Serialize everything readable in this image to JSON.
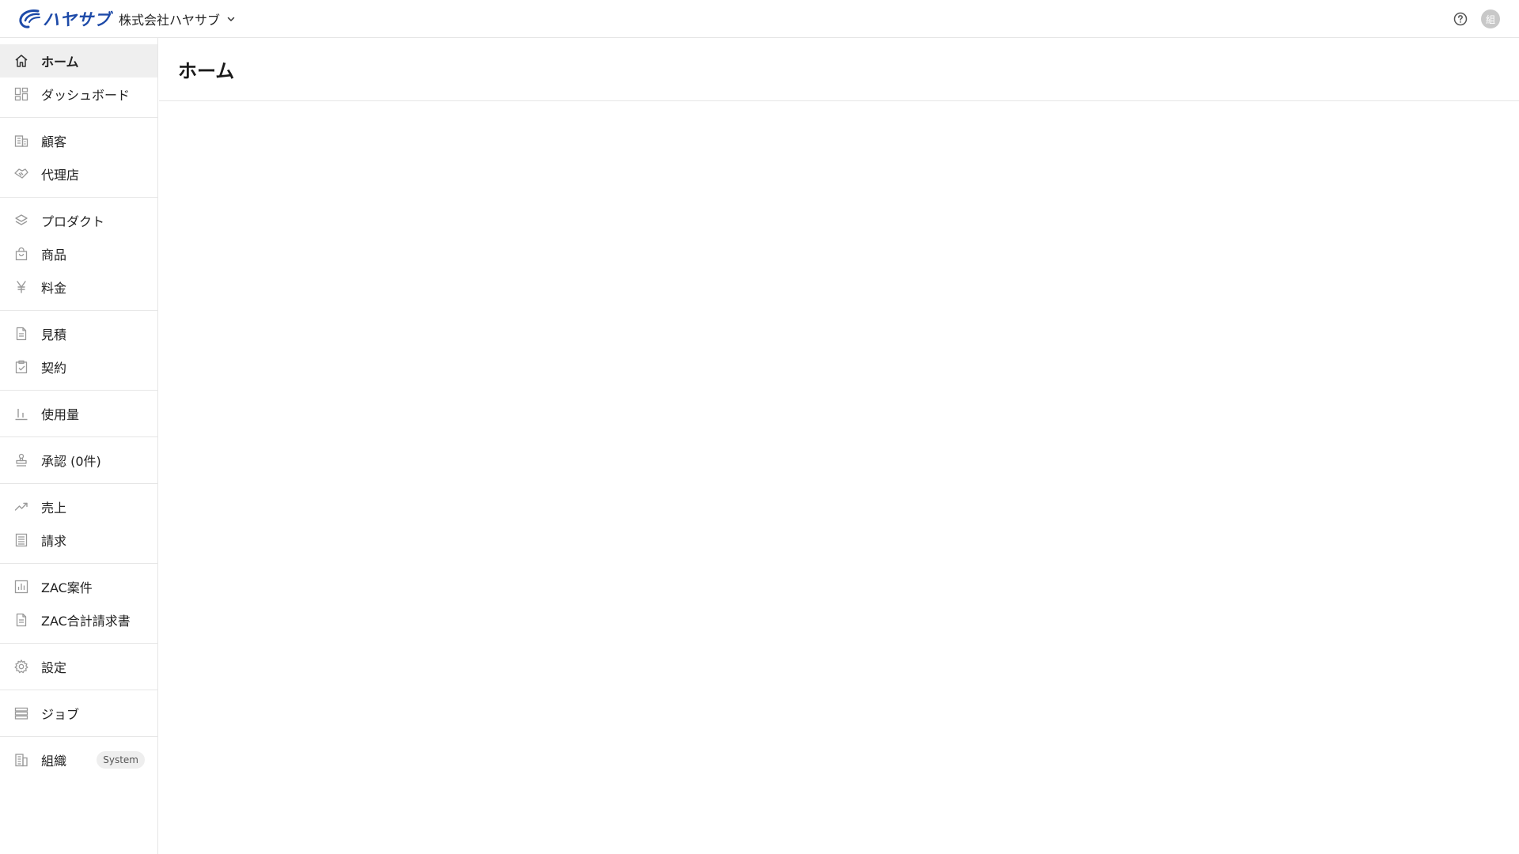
{
  "brand": {
    "logo_text": "ハヤサブ",
    "accent": "#1d4aa8"
  },
  "header": {
    "org_name": "株式会社ハヤサブ",
    "org_dropdown_icon": "chevron-down-icon",
    "help_icon": "help-circle-icon",
    "avatar_initial": "組"
  },
  "sidebar": {
    "items": [
      {
        "label": "ホーム",
        "icon": "home-icon",
        "active": true
      },
      {
        "label": "ダッシュボード",
        "icon": "dashboard-icon"
      },
      {
        "label": "顧客",
        "icon": "building-icon"
      },
      {
        "label": "代理店",
        "icon": "handshake-icon"
      },
      {
        "label": "プロダクト",
        "icon": "layers-icon"
      },
      {
        "label": "商品",
        "icon": "shopping-bag-icon"
      },
      {
        "label": "料金",
        "icon": "yen-icon"
      },
      {
        "label": "見積",
        "icon": "document-icon"
      },
      {
        "label": "契約",
        "icon": "clipboard-check-icon"
      },
      {
        "label": "使用量",
        "icon": "bar-chart-icon"
      },
      {
        "label": "承認 (0件)",
        "icon": "stamp-icon"
      },
      {
        "label": "売上",
        "icon": "trending-up-icon"
      },
      {
        "label": "請求",
        "icon": "list-document-icon"
      },
      {
        "label": "ZAC案件",
        "icon": "chart-box-icon"
      },
      {
        "label": "ZAC合計請求書",
        "icon": "document-icon"
      },
      {
        "label": "設定",
        "icon": "gear-icon"
      },
      {
        "label": "ジョブ",
        "icon": "server-stack-icon"
      },
      {
        "label": "組織",
        "icon": "office-building-icon",
        "badge": "System"
      }
    ]
  },
  "main": {
    "page_title": "ホーム"
  }
}
